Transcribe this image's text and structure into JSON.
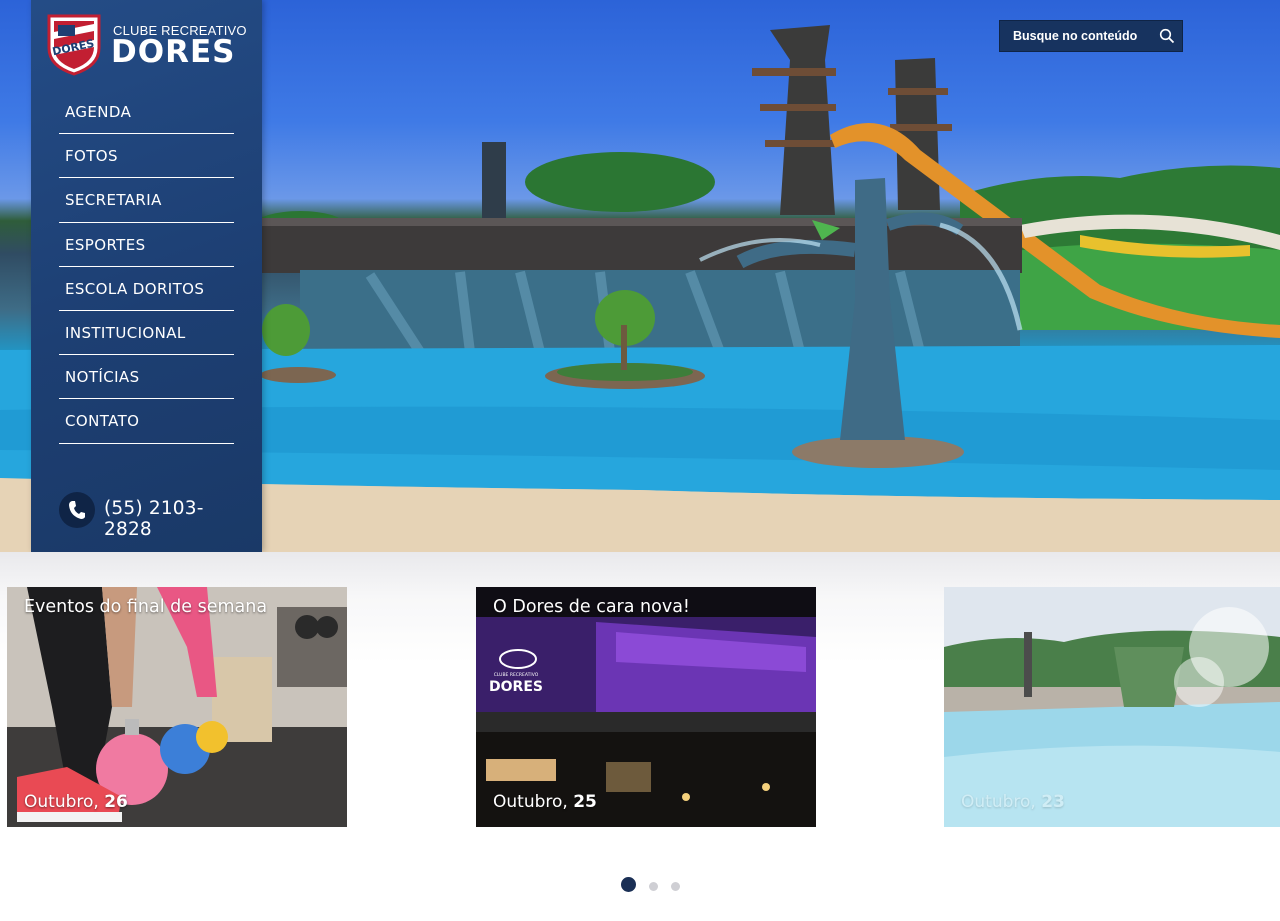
{
  "brand": {
    "small": "CLUBE RECREATIVO",
    "big": "DORES",
    "badge_text": "DORES"
  },
  "menu": [
    {
      "label": "AGENDA"
    },
    {
      "label": "FOTOS"
    },
    {
      "label": "SECRETARIA"
    },
    {
      "label": "ESPORTES"
    },
    {
      "label": "ESCOLA DORITOS"
    },
    {
      "label": "INSTITUCIONAL"
    },
    {
      "label": "NOTÍCIAS"
    },
    {
      "label": "CONTATO"
    }
  ],
  "phone": "(55) 2103-2828",
  "search": {
    "placeholder": "Busque no conteúdo"
  },
  "news": [
    {
      "title": "Eventos do final de semana",
      "month": "Outubro,",
      "day": "26"
    },
    {
      "title": "O Dores de cara nova!",
      "month": "Outubro,",
      "day": "25"
    },
    {
      "title": "",
      "month": "Outubro,",
      "day": "23"
    }
  ],
  "building_sign": {
    "small": "CLUBE RECREATIVO",
    "big": "DORES"
  },
  "carousel": {
    "active_index": 0,
    "count": 3
  },
  "colors": {
    "sidebar": "#1d3f73",
    "search_bg": "#17335f",
    "dot_active": "#1a2f55",
    "dot_inactive": "#cfcfd4"
  }
}
